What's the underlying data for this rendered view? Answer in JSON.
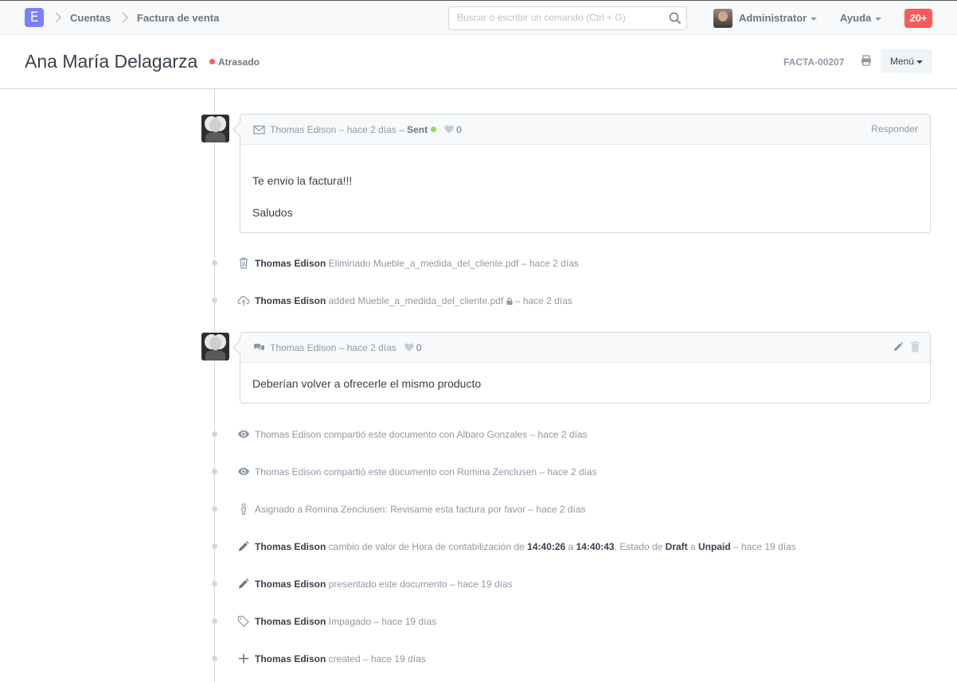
{
  "navbar": {
    "logo_letter": "E",
    "breadcrumbs": [
      "Cuentas",
      "Factura de venta"
    ],
    "search_placeholder": "Buscar o escribir un comando (Ctrl + G)",
    "user_label": "Administrator",
    "help_label": "Ayuda",
    "notifications": "20+"
  },
  "page": {
    "title": "Ana María Delagarza",
    "status": "Atrasado",
    "doc_id": "FACTA-00207",
    "menu_label": "Menú"
  },
  "timeline": {
    "email": {
      "meta": "Thomas Edison – hace 2 días –",
      "sent": "Sent",
      "likes": "0",
      "reply": "Responder",
      "line1": "Te envio la factura!!!",
      "line2": "Saludos"
    },
    "ev_deleted": {
      "user": "Thomas Edison",
      "text": " Eliminado Mueble_a_medida_del_cliente.pdf – hace 2 días"
    },
    "ev_added": {
      "user": "Thomas Edison",
      "text": " added Mueble_a_medida_del_cliente.pdf",
      "time": " – hace 2 días"
    },
    "comment": {
      "meta": "Thomas Edison – hace 2 días",
      "likes": "0",
      "body": "Deberían volver a ofrecerle el mismo producto"
    },
    "ev_share1": "Thomas Edison compartió este documento con Albaro Gonzales – hace 2 días",
    "ev_share2": "Thomas Edison compartió este documento con Romina Zenclusen – hace 2 días",
    "ev_assign": "Asignado a Romina Zenclusen: Revisame esta factura por favor – hace 2 días",
    "ev_change": {
      "user": "Thomas Edison",
      "t1": " cambio de valor de Hora de contabilización de ",
      "v1": "14:40:26",
      "t2": " a ",
      "v2": "14:40:43",
      "t3": ", Estado de ",
      "v3": "Draft",
      "t4": " a ",
      "v4": "Unpaid",
      "t5": " – hace 19 días"
    },
    "ev_submit": {
      "user": "Thomas Edison",
      "text": " presentado este documento – hace 19 días"
    },
    "ev_unpaid": {
      "user": "Thomas Edison",
      "text": " Impagado – hace 19 días"
    },
    "ev_created": {
      "user": "Thomas Edison",
      "text": " created – hace 19 días"
    }
  },
  "colors": {
    "accent": "#7b7ffb",
    "danger": "#ff5858",
    "sent": "#98d85b"
  }
}
